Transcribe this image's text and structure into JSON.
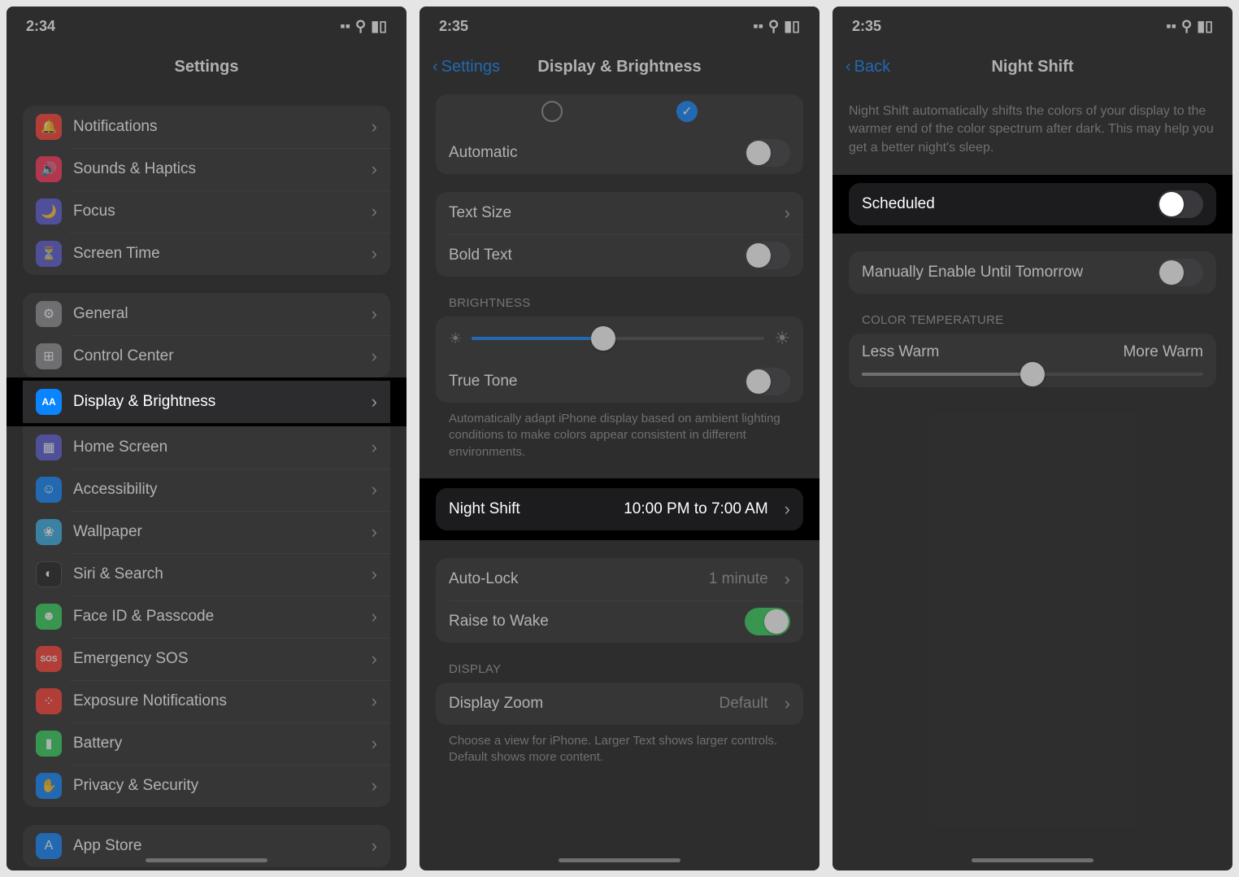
{
  "screen1": {
    "time": "2:34",
    "title": "Settings",
    "groups": [
      [
        {
          "icon": "🔔",
          "bg": "#ff3b30",
          "label": "Notifications"
        },
        {
          "icon": "🔊",
          "bg": "#ff2d55",
          "label": "Sounds & Haptics"
        },
        {
          "icon": "🌙",
          "bg": "#5856d6",
          "label": "Focus"
        },
        {
          "icon": "⏳",
          "bg": "#5856d6",
          "label": "Screen Time"
        }
      ],
      [
        {
          "icon": "⚙︎",
          "bg": "#8e8e93",
          "label": "General"
        },
        {
          "icon": "⊞",
          "bg": "#8e8e93",
          "label": "Control Center"
        },
        {
          "icon": "AA",
          "bg": "#0a84ff",
          "label": "Display & Brightness",
          "hl": true
        },
        {
          "icon": "▦",
          "bg": "#5856d6",
          "label": "Home Screen"
        },
        {
          "icon": "☺",
          "bg": "#0a84ff",
          "label": "Accessibility"
        },
        {
          "icon": "❀",
          "bg": "#32ade6",
          "label": "Wallpaper"
        },
        {
          "icon": "◐",
          "bg": "#1c1c1e",
          "label": "Siri & Search"
        },
        {
          "icon": "☻",
          "bg": "#30d158",
          "label": "Face ID & Passcode"
        },
        {
          "icon": "SOS",
          "bg": "#ff3b30",
          "label": "Emergency SOS"
        },
        {
          "icon": "⁘",
          "bg": "#ff3b30",
          "label": "Exposure Notifications"
        },
        {
          "icon": "▮",
          "bg": "#30d158",
          "label": "Battery"
        },
        {
          "icon": "✋",
          "bg": "#0a84ff",
          "label": "Privacy & Security"
        }
      ],
      [
        {
          "icon": "A",
          "bg": "#0a84ff",
          "label": "App Store"
        }
      ]
    ]
  },
  "screen2": {
    "time": "2:35",
    "back": "Settings",
    "title": "Display & Brightness",
    "automatic": "Automatic",
    "text_size": "Text Size",
    "bold_text": "Bold Text",
    "brightness_header": "BRIGHTNESS",
    "true_tone": "True Tone",
    "true_tone_footer": "Automatically adapt iPhone display based on ambient lighting conditions to make colors appear consistent in different environments.",
    "night_shift": "Night Shift",
    "night_shift_value": "10:00 PM to 7:00 AM",
    "auto_lock": "Auto-Lock",
    "auto_lock_value": "1 minute",
    "raise_to_wake": "Raise to Wake",
    "display_header": "DISPLAY",
    "display_zoom": "Display Zoom",
    "display_zoom_value": "Default",
    "display_zoom_footer": "Choose a view for iPhone. Larger Text shows larger controls. Default shows more content."
  },
  "screen3": {
    "time": "2:35",
    "back": "Back",
    "title": "Night Shift",
    "desc": "Night Shift automatically shifts the colors of your display to the warmer end of the color spectrum after dark. This may help you get a better night's sleep.",
    "scheduled": "Scheduled",
    "manual": "Manually Enable Until Tomorrow",
    "temp_header": "COLOR TEMPERATURE",
    "less_warm": "Less Warm",
    "more_warm": "More Warm"
  }
}
